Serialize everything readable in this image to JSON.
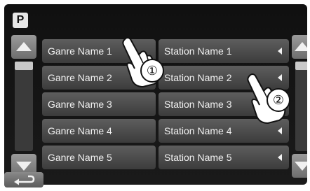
{
  "badge": {
    "label": "P"
  },
  "scroll": {
    "up_icon": "triangle-up-icon",
    "down_icon": "triangle-down-icon"
  },
  "rows": [
    {
      "genre": "Ganre Name 1",
      "station": "Station Name 1"
    },
    {
      "genre": "Ganre Name 2",
      "station": "Station Name 2"
    },
    {
      "genre": "Ganre Name 3",
      "station": "Station Name 3"
    },
    {
      "genre": "Ganre Name 4",
      "station": "Station Name 4"
    },
    {
      "genre": "Ganre Name 5",
      "station": "Station Name 5"
    }
  ],
  "callouts": [
    {
      "label": "①"
    },
    {
      "label": "②"
    }
  ],
  "footer": {
    "back_icon": "return-arrow-icon"
  },
  "colors": {
    "button": "#4a4a4a",
    "background": "#141414",
    "text": "#f2f2f2"
  }
}
